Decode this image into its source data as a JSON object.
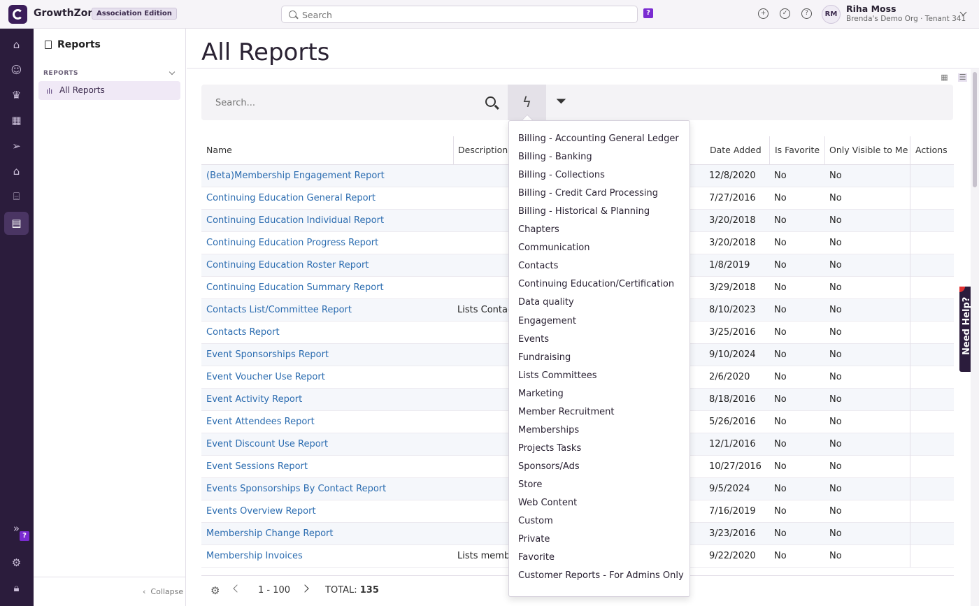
{
  "app": {
    "brand": "GrowthZone",
    "edition": "Association Edition"
  },
  "top_search": {
    "placeholder": "Search"
  },
  "help_badge": "?",
  "user": {
    "initials": "RM",
    "name": "Riha Moss",
    "org": "Brenda's Demo Org · Tenant 341"
  },
  "rail_icons": [
    "home-icon",
    "person-icon",
    "crown-icon",
    "calendar-icon",
    "send-icon",
    "store-icon",
    "bank-icon",
    "reports-icon"
  ],
  "sidebar": {
    "title": "Reports",
    "section": "REPORTS",
    "items": [
      {
        "label": "All Reports"
      }
    ],
    "collapse": "Collapse"
  },
  "page": {
    "title": "All Reports"
  },
  "search": {
    "placeholder": "Search..."
  },
  "table": {
    "columns": [
      "Name",
      "Description",
      "Date Added",
      "Is Favorite",
      "Only Visible to Me",
      "Actions"
    ],
    "rows": [
      {
        "name": "(Beta)Membership Engagement Report",
        "desc": "",
        "date": "12/8/2020",
        "fav": "No",
        "vis": "No"
      },
      {
        "name": "Continuing Education General Report",
        "desc": "",
        "date": "7/27/2016",
        "fav": "No",
        "vis": "No"
      },
      {
        "name": "Continuing Education Individual Report",
        "desc": "",
        "date": "3/20/2018",
        "fav": "No",
        "vis": "No"
      },
      {
        "name": "Continuing Education Progress Report",
        "desc": "",
        "date": "3/20/2018",
        "fav": "No",
        "vis": "No"
      },
      {
        "name": "Continuing Education Roster Report",
        "desc": "",
        "date": "1/8/2019",
        "fav": "No",
        "vis": "No"
      },
      {
        "name": "Continuing Education Summary Report",
        "desc": "",
        "date": "3/29/2018",
        "fav": "No",
        "vis": "No"
      },
      {
        "name": "Contacts List/Committee Report",
        "desc": "Lists Contac",
        "date": "8/10/2023",
        "fav": "No",
        "vis": "No"
      },
      {
        "name": "Contacts Report",
        "desc": "",
        "date": "3/25/2016",
        "fav": "No",
        "vis": "No"
      },
      {
        "name": "Event Sponsorships Report",
        "desc": "",
        "date": "9/10/2024",
        "fav": "No",
        "vis": "No"
      },
      {
        "name": "Event Voucher Use Report",
        "desc": "",
        "date": "2/6/2020",
        "fav": "No",
        "vis": "No"
      },
      {
        "name": "Event Activity Report",
        "desc": "",
        "date": "8/18/2016",
        "fav": "No",
        "vis": "No"
      },
      {
        "name": "Event Attendees Report",
        "desc": "",
        "date": "5/26/2016",
        "fav": "No",
        "vis": "No"
      },
      {
        "name": "Event Discount Use Report",
        "desc": "",
        "date": "12/1/2016",
        "fav": "No",
        "vis": "No"
      },
      {
        "name": "Event Sessions Report",
        "desc": "",
        "date": "10/27/2016",
        "fav": "No",
        "vis": "No"
      },
      {
        "name": "Events Sponsorships By Contact Report",
        "desc": "",
        "date": "9/5/2024",
        "fav": "No",
        "vis": "No"
      },
      {
        "name": "Events Overview Report",
        "desc": "",
        "date": "7/16/2019",
        "fav": "No",
        "vis": "No"
      },
      {
        "name": "Membership Change Report",
        "desc": "",
        "date": "3/23/2016",
        "fav": "No",
        "vis": "No"
      },
      {
        "name": "Membership Invoices",
        "desc": "Lists memb",
        "date": "9/22/2020",
        "fav": "No",
        "vis": "No"
      }
    ]
  },
  "pager": {
    "range": "1 - 100",
    "total_label": "TOTAL:",
    "total": "135"
  },
  "category_dropdown": [
    "Billing - Accounting General Ledger",
    "Billing - Banking",
    "Billing - Collections",
    "Billing - Credit Card Processing",
    "Billing - Historical & Planning",
    "Chapters",
    "Communication",
    "Contacts",
    "Continuing Education/Certification",
    "Data quality",
    "Engagement",
    "Events",
    "Fundraising",
    "Lists Committees",
    "Marketing",
    "Member Recruitment",
    "Memberships",
    "Projects Tasks",
    "Sponsors/Ads",
    "Store",
    "Web Content",
    "Custom",
    "Private",
    "Favorite",
    "Customer Reports - For Admins Only"
  ],
  "need_help": "Need Help?"
}
